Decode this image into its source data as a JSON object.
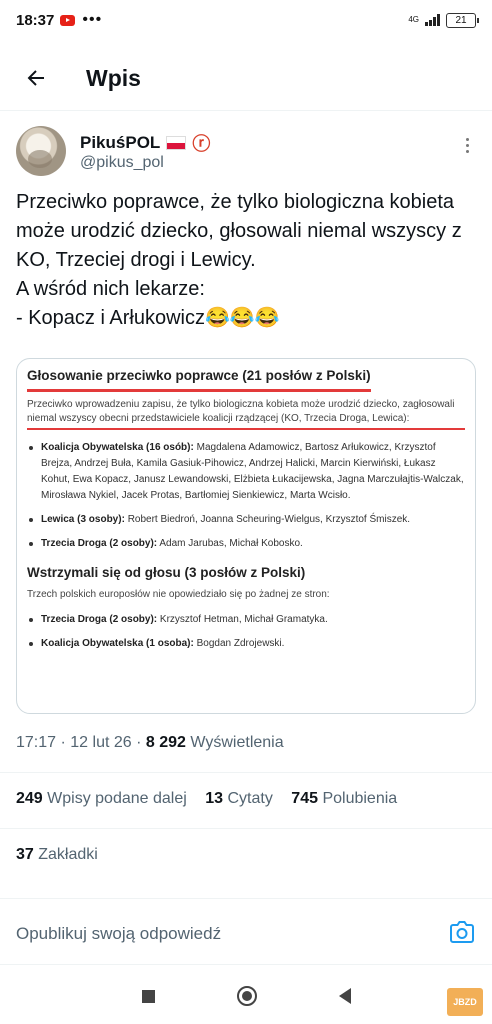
{
  "status_bar": {
    "time": "18:37",
    "overflow_dots": "•••",
    "network": "4G",
    "network_sub": "ıl",
    "battery": "21"
  },
  "header": {
    "title": "Wpis"
  },
  "author": {
    "name": "PikuśPOL",
    "handle": "@pikus_pol",
    "badge": "𐐒"
  },
  "tweet": {
    "text": "Przeciwko poprawce, że tylko biologiczna kobieta może urodzić dziecko, głosowali niemal wszyscy z KO, Trzeciej drogi i Lewicy.\nA wśród nich lekarze:\n- Kopacz i Arłukowicz😂😂😂"
  },
  "document": {
    "heading": "Głosowanie przeciwko poprawce (21 posłów z Polski)",
    "intro": "Przeciwko wprowadzeniu zapisu, że tylko biologiczna kobieta może urodzić dziecko, zagłosowali niemal wszyscy obecni przedstawiciele koalicji rządzącej (KO, Trzecia Droga, Lewica):",
    "groups_against": [
      {
        "label": "Koalicja Obywatelska (16 osób):",
        "members": "Magdalena Adamowicz, Bartosz Arłukowicz, Krzysztof Brejza, Andrzej Buła, Kamila Gasiuk-Pihowicz, Andrzej Halicki, Marcin Kierwiński, Łukasz Kohut, Ewa Kopacz, Janusz Lewandowski, Elżbieta Łukacijewska, Jagna Marczułajtis-Walczak, Mirosława Nykiel, Jacek Protas, Bartłomiej Sienkiewicz, Marta Wcisło."
      },
      {
        "label": "Lewica (3 osoby):",
        "members": "Robert Biedroń, Joanna Scheuring-Wielgus, Krzysztof Śmiszek."
      },
      {
        "label": "Trzecia Droga (2 osoby):",
        "members": "Adam Jarubas, Michał Kobosko."
      }
    ],
    "heading2": "Wstrzymali się od głosu (3 posłów z Polski)",
    "intro2": "Trzech polskich europosłów nie opowiedziało się po żadnej ze stron:",
    "groups_abstain": [
      {
        "label": "Trzecia Droga (2 osoby):",
        "members": "Krzysztof Hetman, Michał Gramatyka."
      },
      {
        "label": "Koalicja Obywatelska (1 osoba):",
        "members": "Bogdan Zdrojewski."
      }
    ]
  },
  "meta": {
    "time": "17:17",
    "separator": "·",
    "date": "12 lut 26",
    "views_count": "8 292",
    "views_label": "Wyświetlenia"
  },
  "stats": {
    "reposts_count": "249",
    "reposts_label": "Wpisy podane dalej",
    "quotes_count": "13",
    "quotes_label": "Cytaty",
    "likes_count": "745",
    "likes_label": "Polubienia",
    "bookmarks_count": "37",
    "bookmarks_label": "Zakładki"
  },
  "reply": {
    "placeholder": "Opublikuj swoją odpowiedź"
  },
  "watermark": "JBZD",
  "colors": {
    "accent": "#1d9bf0",
    "underline": "#e33a3a",
    "secondary_text": "#536471"
  }
}
